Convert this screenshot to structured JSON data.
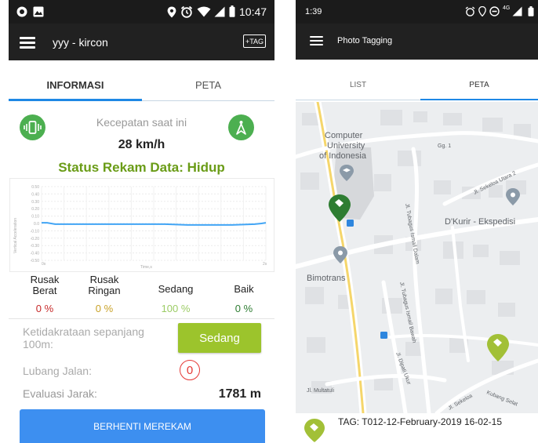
{
  "left_screen": {
    "status_bar": {
      "time": "10:47"
    },
    "toolbar": {
      "title": "yyy - kircon",
      "tag_button_label": "+TAG"
    },
    "tabs": [
      {
        "label": "INFORMASI",
        "active": true
      },
      {
        "label": "PETA",
        "active": false
      }
    ],
    "speed": {
      "label": "Kecepatan saat ini",
      "value": "28 km/h"
    },
    "record_status": "Status Rekam Data: Hidup",
    "chart": {
      "ylabel": "Vertical Acceleration",
      "xlabel": "Time,s",
      "x_ticks": [
        "0s",
        "2s"
      ],
      "y_ticks": [
        "0.50",
        "0.40",
        "0.30",
        "0.20",
        "0.10",
        "0.0",
        "-0.10",
        "-0.20",
        "-0.30",
        "-0.40",
        "-0.50"
      ]
    },
    "chart_data": {
      "type": "line",
      "xlabel": "Time,s",
      "ylabel": "Vertical Acceleration",
      "xlim": [
        0,
        2
      ],
      "ylim": [
        -0.5,
        0.5
      ],
      "grid": true,
      "series": [
        {
          "color": "#42a5f5",
          "x": [
            0,
            0.05,
            0.12,
            0.3,
            0.5,
            0.7,
            0.9,
            1.1,
            1.3,
            1.5,
            1.7,
            1.9,
            1.96,
            2.0
          ],
          "y": [
            0.01,
            0.01,
            -0.01,
            -0.01,
            -0.01,
            -0.01,
            -0.01,
            -0.01,
            -0.02,
            -0.02,
            -0.02,
            -0.01,
            0.0,
            0.01
          ]
        }
      ]
    },
    "categories": [
      {
        "name": "Rusak\nBerat",
        "value": "0 %",
        "color": "#c62828"
      },
      {
        "name": "Rusak\nRingan",
        "value": "0 %",
        "color": "#c9a227"
      },
      {
        "name": "Sedang",
        "value": "100 %",
        "color": "#9ccc65"
      },
      {
        "name": "Baik",
        "value": "0 %",
        "color": "#2e7d32"
      }
    ],
    "unevenness": {
      "label": "Ketidakrataan sepanjang\n100m:",
      "button_label": "Sedang"
    },
    "potholes": {
      "label": "Lubang Jalan:",
      "count": "0"
    },
    "distance": {
      "label": "Evaluasi Jarak:",
      "value": "1781 m"
    },
    "stop_button_label": "BERHENTI MEREKAM",
    "colors": {
      "accent_green": "#4caf50",
      "status_green": "#6a9c17",
      "tab_underline": "#1e88e5",
      "stop_button": "#3d8ff0",
      "sedang_button": "#9cc42c"
    }
  },
  "right_screen": {
    "status_bar": {
      "time": "1:39",
      "network": "4G"
    },
    "toolbar": {
      "title": "Photo Tagging"
    },
    "tabs": [
      {
        "label": "LIST",
        "active": false
      },
      {
        "label": "PETA",
        "active": true
      }
    ],
    "map_labels": {
      "campus": "Computer\nUniversity\nof Indonesia",
      "gg1": "Gg. 1",
      "sekeloa_utara": "Jl. Sekeloa Utara 2",
      "dkurir": "D'Kurir - Ekspedisi",
      "bimotrans": "Bimotrans",
      "tubagus_dalam": "Jl. Tubagus Ismail Dalam",
      "tubagus_bawah": "Jl. Tubagus Ismail Bawah",
      "dipati_ukur": "Jl. Dipati Ukur",
      "multatuli": "Jl. Multatuli",
      "sekeloa": "Jl. Sekeloa",
      "kubang_selatan": "Kubang Selat"
    },
    "tag_info": "TAG: T012-12-February-2019 16-02-15",
    "icons": [
      "tag-pin-dark-green",
      "tag-pin-lime",
      "place-pin-gray",
      "school-pin-gray"
    ]
  }
}
